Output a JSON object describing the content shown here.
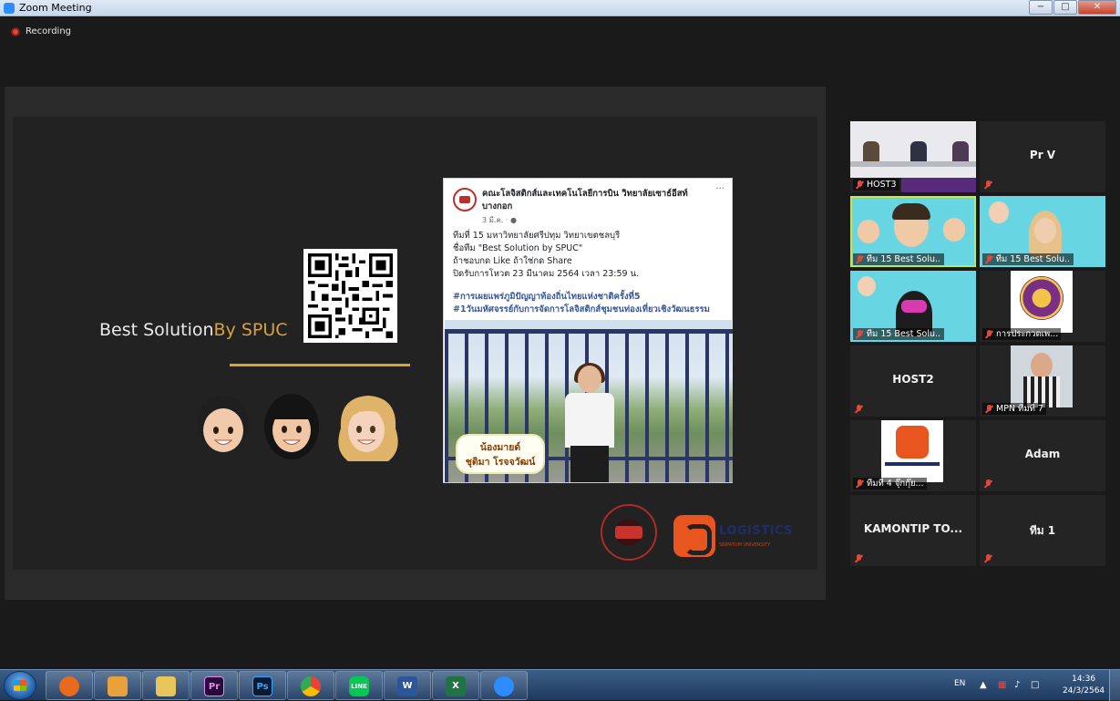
{
  "window": {
    "title": "Zoom Meeting",
    "buttons": {
      "minimize": "−",
      "maximize": "□",
      "close": "✕"
    }
  },
  "recording": {
    "label": "Recording"
  },
  "slide": {
    "title_main": "Best Solution",
    "title_accent": "By SPUC",
    "post": {
      "page_name": "คณะโลจิสติกส์และเทคโนโลยีการบิน วิทยาลัยเซาธ์อีสท์บางกอก",
      "date": "3 มี.ค. · ●",
      "more": "···",
      "lines": [
        "ทีมที่ 15 มหาวิทยาลัยศรีปทุม วิทยาเขตชลบุรี",
        "ชื่อทีม \"Best Solution by SPUC\"",
        "ถ้าชอบกด Like ถ้าใช่กด Share",
        "ปิดรับการโหวต 23 มีนาคม 2564 เวลา 23:59 น."
      ],
      "tags": [
        "#การเผยแพร่ภูมิปัญญาท้องถิ่นไทยแห่งชาติครั้งที่5",
        "#1วันมหัศจรรย์กับการจัดการโลจิสติกส์ชุมชนท่องเที่ยวเชิงวัฒนธรรม"
      ],
      "photo_caption": [
        "น้องมายด์",
        "ชุติมา โรจจวัฒน์"
      ]
    },
    "logos": {
      "ls_name": "LOGISTICS",
      "ls_sub": "SRIPATUM UNIVERSITY"
    }
  },
  "gallery": [
    {
      "name": "HOST3",
      "muted": true,
      "video": "room"
    },
    {
      "name": "Pr V",
      "muted": true,
      "video": "none"
    },
    {
      "name": "ทีม 15 Best Solu...",
      "muted": true,
      "video": "cyan",
      "active": true
    },
    {
      "name": "ทีม 15 Best Solu...",
      "muted": true,
      "video": "cyan"
    },
    {
      "name": "ทีม 15 Best Solu...",
      "muted": true,
      "video": "cyan"
    },
    {
      "name": "การประกวดเพ...",
      "muted": true,
      "video": "emblem"
    },
    {
      "name": "HOST2",
      "muted": true,
      "video": "none"
    },
    {
      "name": "MPN ทีมที่ 7",
      "muted": true,
      "video": "person"
    },
    {
      "name": "ทีมที่ 4 จุ๊กกุ๊ย...",
      "muted": true,
      "video": "ls"
    },
    {
      "name": "Adam",
      "muted": true,
      "video": "none"
    },
    {
      "name": "KAMONTIP  TO...",
      "muted": true,
      "video": "none"
    },
    {
      "name": "ทีม 1",
      "muted": true,
      "video": "none"
    }
  ],
  "taskbar": {
    "apps": [
      "ccleaner-icon",
      "media-player-icon",
      "explorer-icon",
      "premiere-icon",
      "photoshop-icon",
      "chrome-icon",
      "line-icon",
      "word-icon",
      "excel-icon",
      "zoom-icon"
    ],
    "app_labels": {
      "premiere": "Pr",
      "photoshop": "Ps",
      "line": "LINE",
      "word": "W",
      "excel": "X"
    },
    "lang": "EN",
    "time": "14:36",
    "date": "24/3/2564"
  },
  "colors": {
    "accent_gold": "#d8a13c",
    "active_speaker": "#c3e84b",
    "muted_red": "#e04a3c",
    "zoom_blue": "#2d8cff"
  }
}
